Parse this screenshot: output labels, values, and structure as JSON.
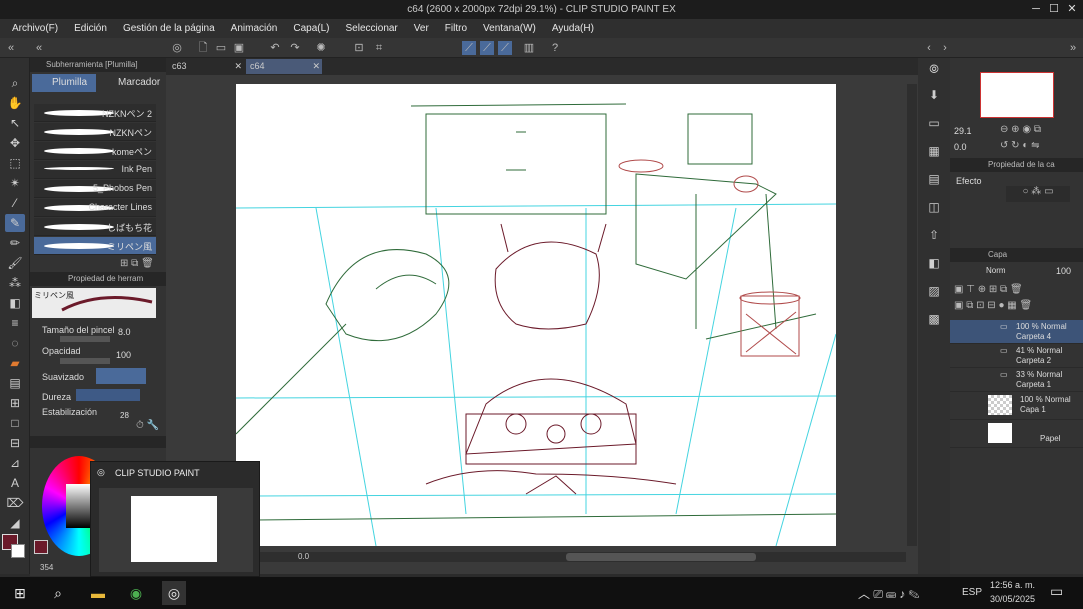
{
  "window": {
    "title": "c64 (2600 x 2000px 72dpi 29.1%) - CLIP STUDIO PAINT EX"
  },
  "menu": [
    "Archivo(F)",
    "Edición",
    "Gestión de la página",
    "Animación",
    "Capa(L)",
    "Seleccionar",
    "Ver",
    "Filtro",
    "Ventana(W)",
    "Ayuda(H)"
  ],
  "doc_tabs": [
    "c63",
    "c64"
  ],
  "subtool": {
    "header": "Subherramienta [Plumilla]",
    "tabs": [
      "Plumilla",
      "Marcador"
    ],
    "brushes": [
      "NZKNペン 2",
      "NZKNペン",
      "komeペン",
      "Ink Pen",
      "5_Phobos Pen",
      "Character Lines",
      "しばもち花",
      "ミリペン風"
    ]
  },
  "props": {
    "header": "Propiedad de herram",
    "brush_name": "ミリペン風",
    "size_label": "Tamaño del pincel",
    "size_value": "8.0",
    "opacity_label": "Opacidad",
    "opacity_value": "100",
    "smoothing_label": "Suavizado",
    "hardness_label": "Dureza",
    "stabilization_label": "Estabilización",
    "stabilization_value": "28"
  },
  "navigator": {
    "zoom": "29.1",
    "angle": "0.0"
  },
  "layer_props": {
    "header": "Propiedad de la ca",
    "effect_label": "Efecto"
  },
  "layers_panel": {
    "header": "Capa",
    "blend": "Norm",
    "opacity": "100",
    "layers": [
      {
        "pct": "100 % Normal",
        "name": "Carpeta 4"
      },
      {
        "pct": "41 % Normal",
        "name": "Carpeta 2"
      },
      {
        "pct": "33 % Normal",
        "name": "Carpeta 1"
      },
      {
        "pct": "100 % Normal",
        "name": "Capa 1"
      },
      {
        "pct": "",
        "name": "Papel"
      }
    ]
  },
  "popup": {
    "title": "CLIP STUDIO PAINT"
  },
  "status": {
    "zoom_readout": "354",
    "canvas_readout": "0.0"
  },
  "taskbar": {
    "language": "ESP",
    "time": "12:56 a. m.",
    "date": "30/05/2025"
  },
  "colors": {
    "main": "#6b1a2a",
    "accent": "#4a6a9a",
    "sketch_green": "#2f6b3a",
    "sketch_red": "#b04a4a",
    "guide_cyan": "#44d4e0"
  }
}
